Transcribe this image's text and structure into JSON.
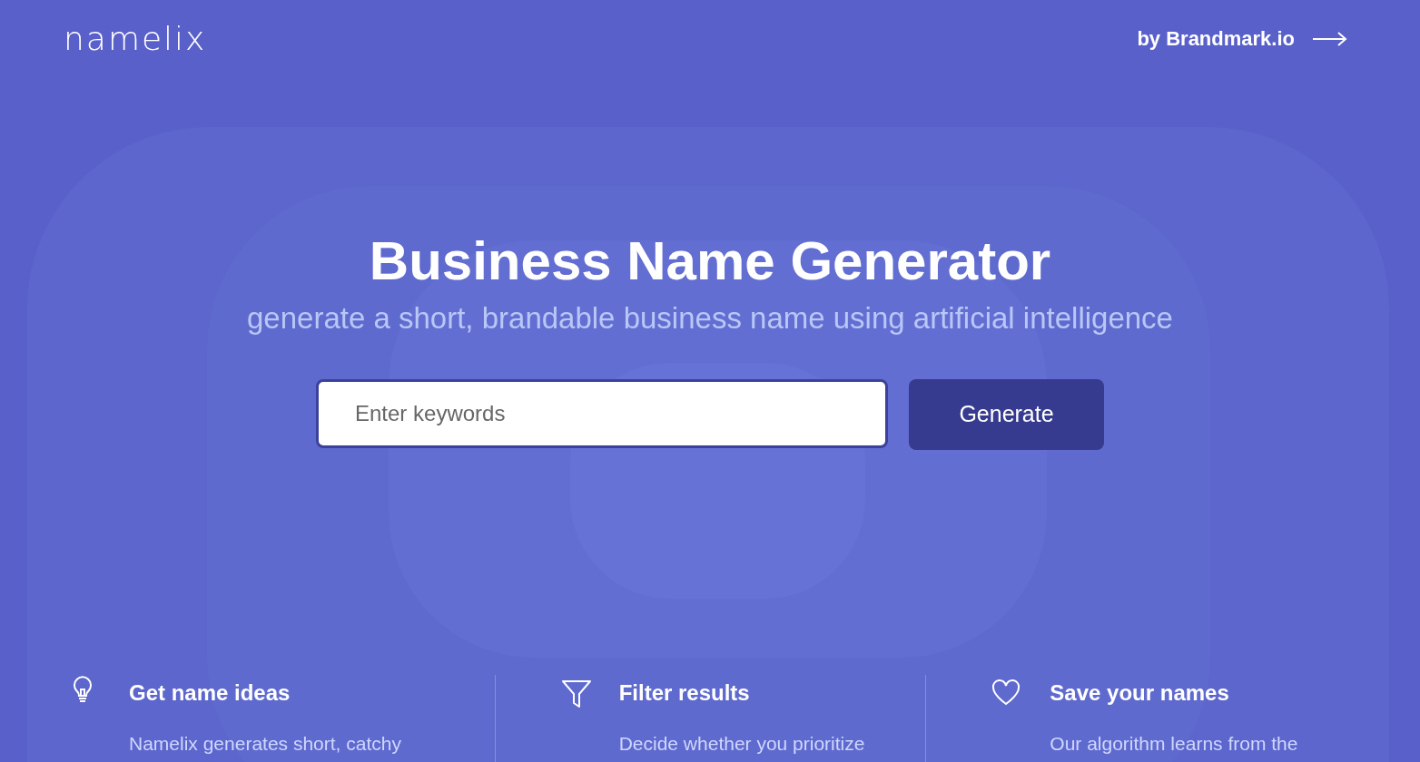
{
  "header": {
    "logo": "namelix",
    "partner_link": "by Brandmark.io"
  },
  "hero": {
    "title": "Business Name Generator",
    "subtitle": "generate a short, brandable business name using artificial intelligence",
    "search": {
      "placeholder": "Enter keywords"
    },
    "button": "Generate"
  },
  "features": [
    {
      "kind": "bulb",
      "title": "Get name ideas",
      "description": "Namelix generates short, catchy"
    },
    {
      "kind": "filter",
      "title": "Filter results",
      "description": "Decide whether you prioritize"
    },
    {
      "kind": "heart",
      "title": "Save your names",
      "description": "Our algorithm learns from the"
    }
  ]
}
